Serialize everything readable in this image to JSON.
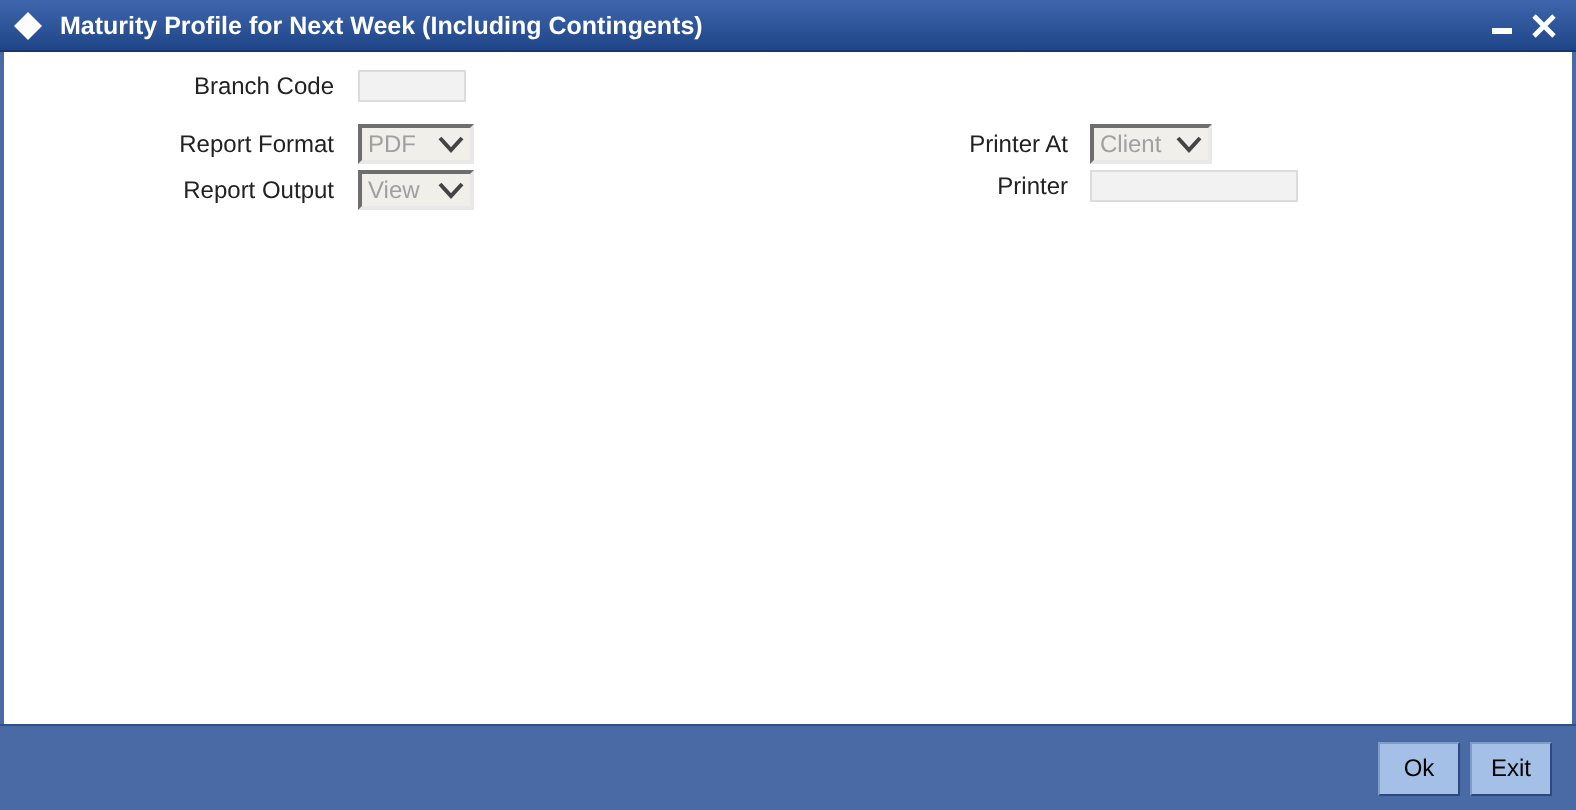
{
  "window": {
    "title": "Maturity Profile for Next Week (Including Contingents)"
  },
  "branch_code": {
    "label": "Branch Code",
    "disabled": true
  },
  "left_fields": [
    {
      "kind": "select",
      "label": "Report Format",
      "value": "PDF",
      "disabled": true
    },
    {
      "kind": "select",
      "label": "Report Output",
      "value": "View",
      "disabled": true
    }
  ],
  "right_fields": [
    {
      "kind": "select",
      "label": "Printer At",
      "value": "Client",
      "disabled": true
    },
    {
      "kind": "text",
      "label": "Printer",
      "disabled": true
    }
  ],
  "buttons": [
    "Ok",
    "Exit"
  ]
}
